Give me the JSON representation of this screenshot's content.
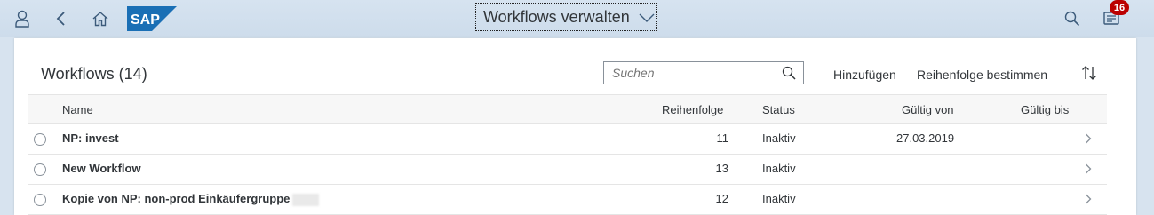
{
  "shell": {
    "title": "Workflows verwalten",
    "notification_count": "16",
    "logo_text": "SAP",
    "brand_color": "#1a6fb5"
  },
  "toolbar": {
    "title": "Workflows (14)",
    "search_placeholder": "Suchen",
    "add_label": "Hinzufügen",
    "order_label": "Reihenfolge bestimmen"
  },
  "table": {
    "columns": {
      "name": "Name",
      "order": "Reihenfolge",
      "status": "Status",
      "valid_from": "Gültig von",
      "valid_to": "Gültig bis"
    },
    "rows": [
      {
        "name": "NP: invest",
        "order": "11",
        "status": "Inaktiv",
        "valid_from": "27.03.2019",
        "valid_to": ""
      },
      {
        "name": "New Workflow",
        "order": "13",
        "status": "Inaktiv",
        "valid_from": "",
        "valid_to": ""
      },
      {
        "name": "Kopie von NP: non-prod Einkäufergruppe",
        "order": "12",
        "status": "Inaktiv",
        "valid_from": "",
        "valid_to": ""
      }
    ]
  }
}
